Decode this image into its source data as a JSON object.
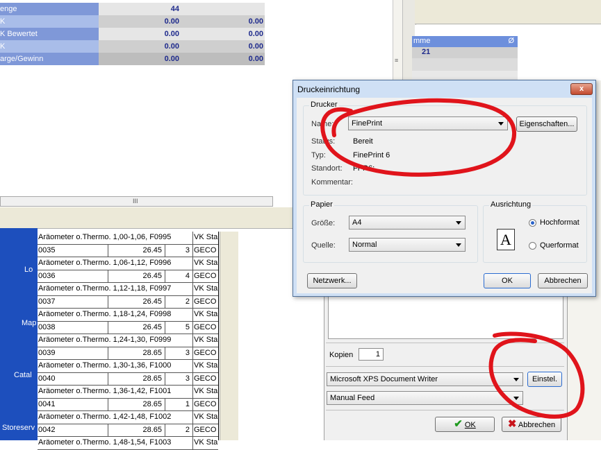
{
  "stats": {
    "rows": [
      {
        "label": "enge",
        "v1": "44",
        "v2": ""
      },
      {
        "label": "K",
        "v1": "0.00",
        "v2": "0.00"
      },
      {
        "label": "K Bewertet",
        "v1": "0.00",
        "v2": "0.00"
      },
      {
        "label": "K",
        "v1": "0.00",
        "v2": "0.00"
      },
      {
        "label": "arge/Gewinn",
        "v1": "0.00",
        "v2": "0.00"
      }
    ],
    "partial_top": "0"
  },
  "summary": {
    "header": "mme",
    "header_symbol": "Ø",
    "value": "21"
  },
  "desktop": {
    "labels": [
      "Lo",
      "Map",
      "Catal",
      "Storeserv"
    ]
  },
  "list": {
    "rows": [
      {
        "name": "Aräometer o.Thermo. 1,00-1,06, F0995",
        "vk": "VK Sta"
      },
      {
        "nr": "0035",
        "price": "26.45",
        "qty": "3",
        "sup": "GECO"
      },
      {
        "name": "Aräometer o.Thermo. 1,06-1,12, F0996",
        "vk": "VK Sta"
      },
      {
        "nr": "0036",
        "price": "26.45",
        "qty": "4",
        "sup": "GECO"
      },
      {
        "name": "Aräometer o.Thermo. 1,12-1,18, F0997",
        "vk": "VK Sta"
      },
      {
        "nr": "0037",
        "price": "26.45",
        "qty": "2",
        "sup": "GECO"
      },
      {
        "name": "Aräometer o.Thermo. 1,18-1,24, F0998",
        "vk": "VK Sta"
      },
      {
        "nr": "0038",
        "price": "26.45",
        "qty": "5",
        "sup": "GECO"
      },
      {
        "name": "Aräometer o.Thermo. 1,24-1,30, F0999",
        "vk": "VK Sta"
      },
      {
        "nr": "0039",
        "price": "28.65",
        "qty": "3",
        "sup": "GECO"
      },
      {
        "name": "Aräometer o.Thermo. 1,30-1,36, F1000",
        "vk": "VK Sta"
      },
      {
        "nr": "0040",
        "price": "28.65",
        "qty": "3",
        "sup": "GECO"
      },
      {
        "name": "Aräometer o.Thermo. 1,36-1,42, F1001",
        "vk": "VK Sta"
      },
      {
        "nr": "0041",
        "price": "28.65",
        "qty": "1",
        "sup": "GECO"
      },
      {
        "name": "Aräometer o.Thermo. 1,42-1,48, F1002",
        "vk": "VK Sta"
      },
      {
        "nr": "0042",
        "price": "28.65",
        "qty": "2",
        "sup": "GECO"
      },
      {
        "name": "Aräometer o.Thermo. 1,48-1,54, F1003",
        "vk": "VK Sta"
      }
    ]
  },
  "print_panel": {
    "kopien_label": "Kopien",
    "kopien_value": "1",
    "printer": "Microsoft XPS Document Writer",
    "einstel_label": "Einstel.",
    "feed": "Manual Feed",
    "ok_label": "OK",
    "abbrechen_label": "Abbrechen"
  },
  "dialog": {
    "title": "Druckeinrichtung",
    "close_label": "x",
    "drucker_group": "Drucker",
    "name_label": "Name:",
    "name_value": "FinePrint",
    "eigenschaften_label": "Eigenschaften...",
    "status_label": "Status:",
    "status_value": "Bereit",
    "typ_label": "Typ:",
    "typ_value": "FinePrint 6",
    "standort_label": "Standort:",
    "standort_value": "FPR6:",
    "kommentar_label": "Kommentar:",
    "papier_group": "Papier",
    "groesse_label": "Größe:",
    "groesse_value": "A4",
    "quelle_label": "Quelle:",
    "quelle_value": "Normal",
    "ausrichtung_group": "Ausrichtung",
    "hoch_label": "Hochformat",
    "quer_label": "Querformat",
    "page_glyph": "A",
    "netzwerk_label": "Netzwerk...",
    "ok_label": "OK",
    "abbrechen_label": "Abbrechen"
  },
  "colors": {
    "annotation": "#e0141b",
    "dialog_frame": "#cfe0f5",
    "desktop": "#1d4fbd"
  }
}
